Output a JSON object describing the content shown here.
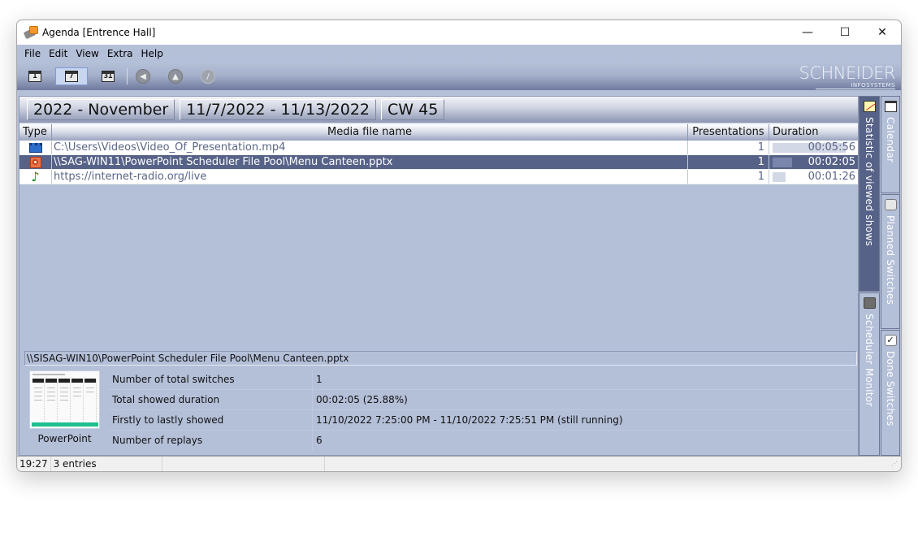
{
  "window": {
    "title": "Agenda [Entrence Hall]",
    "controls": {
      "minimize": "—",
      "maximize": "☐",
      "close": "✕"
    }
  },
  "menu": [
    "File",
    "Edit",
    "View",
    "Extra",
    "Help"
  ],
  "toolbar": {
    "view_day": "1",
    "view_week": "7",
    "view_month": "31",
    "active_view": "week",
    "buttons": [
      {
        "name": "back-icon",
        "glyph": "◀"
      },
      {
        "name": "up-icon",
        "glyph": "▲"
      },
      {
        "name": "edit-icon",
        "glyph": "/"
      }
    ]
  },
  "logo": {
    "main": "SCHNEIDER",
    "sub": "INFOSYSTEMS"
  },
  "period": {
    "month": "2022 - November",
    "range": "11/7/2022 - 11/13/2022",
    "week": "CW 45"
  },
  "table": {
    "columns": [
      "Type",
      "Media file name",
      "Presentations",
      "Duration"
    ],
    "rows": [
      {
        "type": "video",
        "name": "C:\\Users\\Videos\\Video_Of_Presentation.mp4",
        "presentations": "1",
        "duration": "00:05:56",
        "bar_fraction": 1.0,
        "selected": false
      },
      {
        "type": "powerpoint",
        "name": "\\\\SAG-WIN11\\PowerPoint Scheduler File Pool\\Menu Canteen.pptx",
        "presentations": "1",
        "duration": "00:02:05",
        "bar_fraction": 0.27,
        "selected": true
      },
      {
        "type": "audio",
        "name": "https://internet-radio.org/live",
        "presentations": "1",
        "duration": "00:01:26",
        "bar_fraction": 0.18,
        "selected": false
      }
    ]
  },
  "detail": {
    "path": "\\\\SISAG-WIN10\\PowerPoint Scheduler File Pool\\Menu Canteen.pptx",
    "thumbnail_caption": "PowerPoint",
    "stats": [
      {
        "label": "Number of total switches",
        "value": "1"
      },
      {
        "label": "Total showed duration",
        "value": "00:02:05 (25.88%)"
      },
      {
        "label": "Firstly to lastly showed",
        "value": "11/10/2022 7:25:00 PM - 11/10/2022 7:25:51 PM  (still running)"
      },
      {
        "label": "Number of replays",
        "value": "6"
      }
    ]
  },
  "side_tabs": [
    {
      "label": "Statistic of viewed shows",
      "icon": "statistic-icon",
      "active": true
    },
    {
      "label": "Calendar",
      "icon": "calendar-icon",
      "active": false
    },
    {
      "label": "Planned Switches",
      "icon": "planned-switches-icon",
      "active": false
    },
    {
      "label": "Scheduler Monitor",
      "icon": "scheduler-monitor-icon",
      "active": false
    },
    {
      "label": "Done Switches",
      "icon": "done-switches-icon",
      "active": false
    }
  ],
  "statusbar": {
    "time": "19:27",
    "entries": "3 entries"
  },
  "colors": {
    "panel": "#b4bfd8",
    "selection": "#566287",
    "row_text": "#5a6687"
  }
}
